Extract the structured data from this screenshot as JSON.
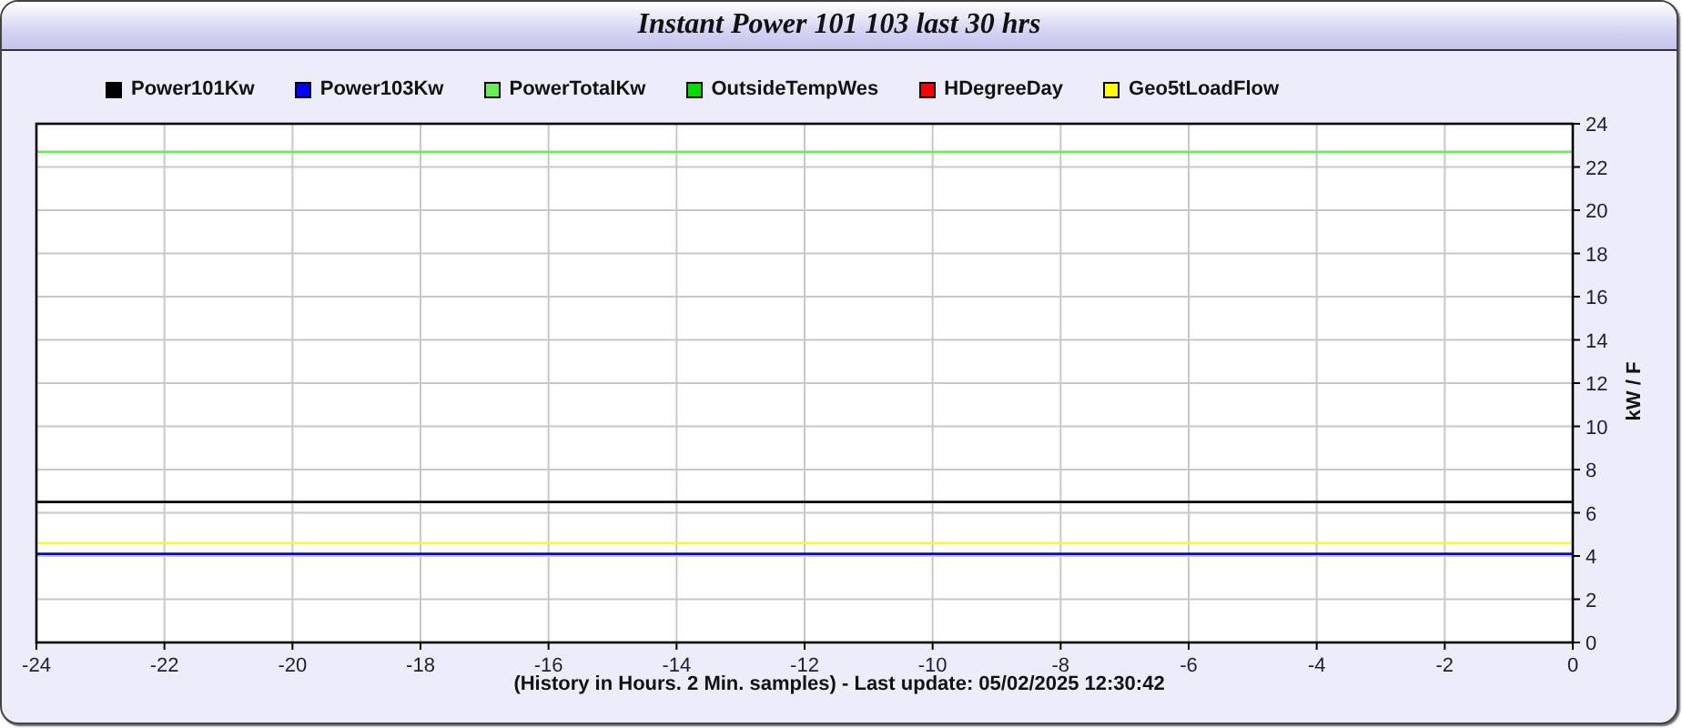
{
  "window": {
    "title": "Instant Power 101 103 last 30 hrs"
  },
  "chart": {
    "chart_data": {
      "type": "line",
      "xlabel": "(History in Hours. 2 Min. samples) - Last update: 05/02/2025 12:30:42",
      "ylabel": "kW / F",
      "x": [
        -24,
        0
      ],
      "series": [
        {
          "name": "Power101Kw",
          "color": "#000000",
          "values": [
            6.5,
            6.5
          ]
        },
        {
          "name": "Power103Kw",
          "color": "#0000ff",
          "values": [
            4.1,
            4.1
          ]
        },
        {
          "name": "PowerTotalKw",
          "color": "#66ee55",
          "values": [
            22.7,
            22.7
          ]
        },
        {
          "name": "OutsideTempWes",
          "color": "#00dd00",
          "values": [
            null,
            null
          ]
        },
        {
          "name": "HDegreeDay",
          "color": "#ff0000",
          "values": [
            null,
            null
          ]
        },
        {
          "name": "Geo5tLoadFlow",
          "color": "#ffff00",
          "values": [
            4.6,
            4.6
          ]
        }
      ],
      "xlim": [
        -24,
        0
      ],
      "ylim": [
        0,
        24
      ],
      "xticks": [
        -24,
        -22,
        -20,
        -18,
        -16,
        -14,
        -12,
        -10,
        -8,
        -6,
        -4,
        -2,
        0
      ],
      "yticks": [
        0,
        2,
        4,
        6,
        8,
        10,
        12,
        14,
        16,
        18,
        20,
        22,
        24
      ],
      "grid": true
    }
  }
}
